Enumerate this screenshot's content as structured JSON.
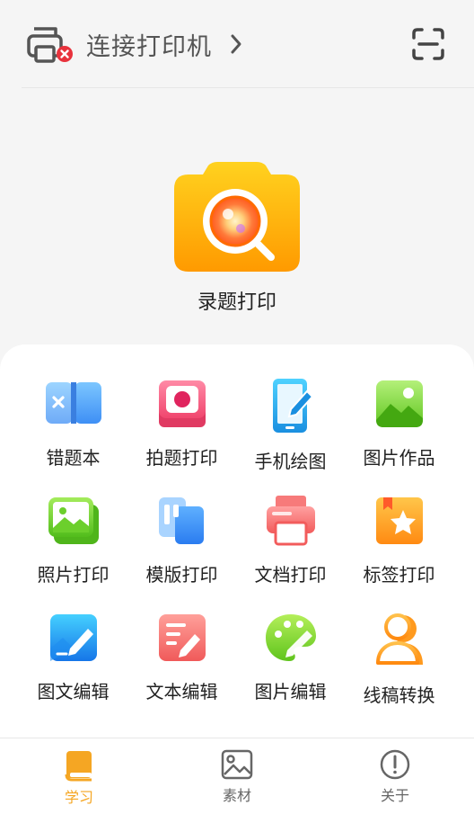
{
  "header": {
    "printer_label": "连接打印机",
    "printer_icon": "printer-disconnected-icon",
    "scan_icon": "scan-icon"
  },
  "hero": {
    "label": "录题打印",
    "icon": "camera-icon"
  },
  "features": [
    {
      "label": "错题本",
      "icon": "notebook-icon"
    },
    {
      "label": "拍题打印",
      "icon": "photo-print-icon"
    },
    {
      "label": "手机绘图",
      "icon": "phone-draw-icon"
    },
    {
      "label": "图片作品",
      "icon": "image-gallery-icon"
    },
    {
      "label": "照片打印",
      "icon": "photo-icon"
    },
    {
      "label": "模版打印",
      "icon": "template-icon"
    },
    {
      "label": "文档打印",
      "icon": "document-printer-icon"
    },
    {
      "label": "标签打印",
      "icon": "label-star-icon"
    },
    {
      "label": "图文编辑",
      "icon": "image-text-edit-icon"
    },
    {
      "label": "文本编辑",
      "icon": "text-edit-icon"
    },
    {
      "label": "图片编辑",
      "icon": "palette-icon"
    },
    {
      "label": "线稿转换",
      "icon": "line-art-icon"
    }
  ],
  "tabs": [
    {
      "label": "学习",
      "icon": "book-icon",
      "active": true
    },
    {
      "label": "素材",
      "icon": "image-icon",
      "active": false
    },
    {
      "label": "关于",
      "icon": "info-icon",
      "active": false
    }
  ],
  "colors": {
    "accent": "#f5a623",
    "text": "#222222",
    "muted": "#666666"
  }
}
